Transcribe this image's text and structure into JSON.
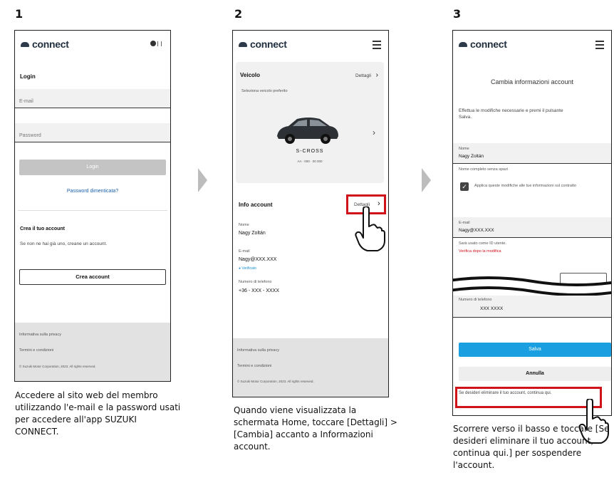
{
  "steps": [
    {
      "number": "1",
      "caption": "Accedere al sito web del membro utilizzando l'e-mail e la password usati per accedere all'app SUZUKI CONNECT.",
      "screen": {
        "logo": "connect",
        "login_heading": "Login",
        "email_placeholder": "E-mail",
        "password_placeholder": "Password",
        "login_button": "Login",
        "forgot_link": "Password dimenticata?",
        "create_heading": "Crea il tuo account",
        "create_text": "Se non ne hai già uno, creane un account.",
        "create_button": "Crea account",
        "footer": [
          "Informativa sulla privacy",
          "Termini e condizioni",
          "© Suzuki Motor Corporation, 2023. All rights reserved."
        ]
      }
    },
    {
      "number": "2",
      "caption": "Quando viene visualizzata la schermata Home, toccare [Dettagli] > [Cambia] accanto a Informazioni account.",
      "screen": {
        "logo": "connect",
        "vehicle_heading": "Veicolo",
        "vehicle_details": "Dettagli",
        "vehicle_sub": "Seleziona veicolo preferito",
        "vehicle_model": "S-CROSS",
        "vehicle_plate": "AA · 000 · 00 000",
        "account_heading": "Info account",
        "account_details": "Dettagli",
        "name_label": "Nome",
        "name_value": "Nagy Zoltán",
        "email_label": "E-mail",
        "email_value": "Nagy@XXX.XXX",
        "verified": "Verificato",
        "phone_label": "Numero di telefono",
        "phone_value": "+36 - XXX - XXXX",
        "footer": [
          "Informativa sulla privacy",
          "Termini e condizioni",
          "© Suzuki Motor Corporation, 2023. All rights reserved."
        ]
      }
    },
    {
      "number": "3",
      "caption": "Scorrere verso il basso e toccare [Se desideri eliminare il tuo account, continua qui.] per sospendere l'account.",
      "screen": {
        "logo": "connect",
        "title": "Cambia informazioni account",
        "intro": "Effettua le modifiche necessarie e premi il pulsante Salva.",
        "name_label": "Nome",
        "name_value": "Nagy Zoltán",
        "name_hint": "Nome completo senza spazi",
        "consent_text": "Applica queste modifiche alle tue informazioni sul contratto",
        "email_label": "E-mail",
        "email_value": "Nagy@XXX.XXX",
        "email_hint": "Sarà usato come ID utente.",
        "email_warning": "Verifica dopo la modifica",
        "phone_label": "Numero di telefono",
        "phone_value": "XXX XXXX",
        "save_button": "Salva",
        "cancel_button": "Annulla",
        "delete_link": "Se desideri eliminare il tuo account, continua qui."
      }
    }
  ],
  "colors": {
    "highlight": "#d0121b",
    "save_blue": "#1aa0e0",
    "arrow_grey": "#bdbdbd"
  }
}
